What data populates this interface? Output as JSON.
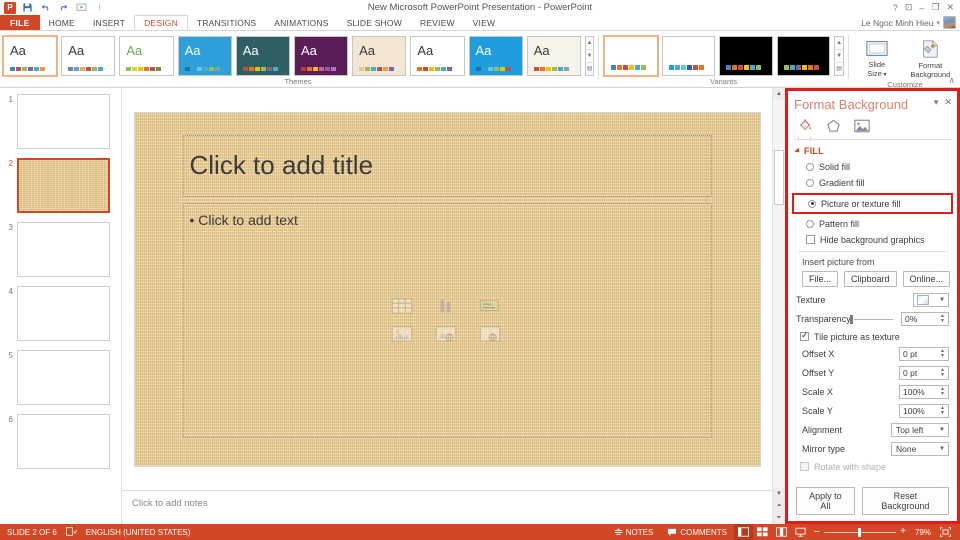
{
  "titlebar": {
    "app_logo": "powerpoint-logo",
    "title": "New Microsoft PowerPoint Presentation - PowerPoint",
    "qat": [
      {
        "name": "save-icon",
        "glyph": "■"
      },
      {
        "name": "undo-icon",
        "glyph": "↶"
      },
      {
        "name": "redo-icon",
        "glyph": "↻"
      },
      {
        "name": "start-slideshow-icon",
        "glyph": "▣"
      },
      {
        "name": "customize-qat-icon",
        "glyph": "≡"
      }
    ],
    "window_controls": [
      {
        "name": "help-button",
        "glyph": "?"
      },
      {
        "name": "ribbon-display-options-button",
        "glyph": "⬚"
      },
      {
        "name": "minimize-button",
        "glyph": "–"
      },
      {
        "name": "restore-button",
        "glyph": "❐"
      },
      {
        "name": "close-button",
        "glyph": "✕"
      }
    ]
  },
  "tabs": {
    "file": "FILE",
    "items": [
      {
        "label": "HOME",
        "active": false
      },
      {
        "label": "INSERT",
        "active": false
      },
      {
        "label": "DESIGN",
        "active": true
      },
      {
        "label": "TRANSITIONS",
        "active": false
      },
      {
        "label": "ANIMATIONS",
        "active": false
      },
      {
        "label": "SLIDE SHOW",
        "active": false
      },
      {
        "label": "REVIEW",
        "active": false
      },
      {
        "label": "VIEW",
        "active": false
      }
    ],
    "account_name": "Le Ngoc Minh Hieu"
  },
  "ribbon": {
    "themes_group_label": "Themes",
    "variants_group_label": "Variants",
    "customize_group_label": "Customize",
    "themes": [
      {
        "name": "theme-office",
        "aa": "Aa",
        "selected": true,
        "bg": "#ffffff",
        "aa_color": "#3a3a3a",
        "swatches": [
          "#4f81bd",
          "#c0504d",
          "#9bbb59",
          "#8064a2",
          "#4bacc6",
          "#f79646"
        ]
      },
      {
        "name": "theme-blank",
        "aa": "Aa",
        "selected": false,
        "bg": "#ffffff",
        "aa_color": "#3a3a3a",
        "swatches": [
          "#5a8ac6",
          "#6d9ed4",
          "#f0ad4e",
          "#c0504d",
          "#9bbb59",
          "#4bacc6"
        ]
      },
      {
        "name": "theme-facet",
        "aa": "Aa",
        "selected": false,
        "bg": "#ffffff",
        "aa_color": "#6aa84f",
        "swatches": [
          "#9bbb59",
          "#cbdb2a",
          "#f2c200",
          "#e8751a",
          "#c0504d",
          "#77933c"
        ]
      },
      {
        "name": "theme-ion",
        "aa": "Aa",
        "selected": false,
        "bg": "#2e9fd8",
        "aa_color": "#ffffff",
        "swatches": [
          "#1f6fa8",
          "#2e9fd8",
          "#68c4e0",
          "#4bacc6",
          "#9bbb59",
          "#76a5af"
        ]
      },
      {
        "name": "theme-slice",
        "aa": "Aa",
        "selected": false,
        "bg": "#2e5f63",
        "aa_color": "#ffffff",
        "swatches": [
          "#c0504d",
          "#e8751a",
          "#f2c200",
          "#9bbb59",
          "#8064a2",
          "#4bacc6"
        ]
      },
      {
        "name": "theme-berlin",
        "aa": "Aa",
        "selected": false,
        "bg": "#5b1d57",
        "aa_color": "#ffffff",
        "swatches": [
          "#c0392b",
          "#e8751a",
          "#f2c200",
          "#d45aa2",
          "#8064a2",
          "#c06ad0"
        ]
      },
      {
        "name": "theme-wood-type",
        "aa": "Aa",
        "selected": false,
        "bg": "#f3e7d3",
        "aa_color": "#3a3a3a",
        "swatches": [
          "#e8c98c",
          "#9bbb59",
          "#4bacc6",
          "#c0504d",
          "#f79646",
          "#8064a2"
        ]
      },
      {
        "name": "theme-retrospect",
        "aa": "Aa",
        "selected": false,
        "bg": "#ffffff",
        "aa_color": "#3a3a3a",
        "swatches": [
          "#e8751a",
          "#c0504d",
          "#f2c200",
          "#9bbb59",
          "#4bacc6",
          "#8064a2"
        ]
      },
      {
        "name": "theme-droplet",
        "aa": "Aa",
        "selected": false,
        "bg": "#1f9ede",
        "aa_color": "#ffffff",
        "swatches": [
          "#1f6fa8",
          "#2e9fd8",
          "#68c4e0",
          "#9bbb59",
          "#f2c200",
          "#c0504d"
        ]
      },
      {
        "name": "theme-organic",
        "aa": "Aa",
        "selected": false,
        "bg": "#f7f3e8",
        "aa_color": "#3a3a3a",
        "swatches": [
          "#c0504d",
          "#e8751a",
          "#f2c200",
          "#9bbb59",
          "#4bacc6",
          "#76a5af"
        ]
      }
    ],
    "variants": [
      {
        "name": "variant-1",
        "selected": true,
        "bg": "#ffffff",
        "swatches": [
          "#4f81bd",
          "#e8751a",
          "#c0504d",
          "#f2c200",
          "#4bacc6",
          "#9bbb59"
        ]
      },
      {
        "name": "variant-2",
        "selected": false,
        "bg": "#ffffff",
        "swatches": [
          "#1f9ede",
          "#4bacc6",
          "#68c4e0",
          "#2e5f9e",
          "#c0504d",
          "#e8751a"
        ]
      },
      {
        "name": "variant-3",
        "selected": false,
        "bg": "#000000",
        "swatches": [
          "#4f81bd",
          "#e8751a",
          "#c0504d",
          "#f2c200",
          "#4bacc6",
          "#9bbb59"
        ]
      },
      {
        "name": "variant-4",
        "selected": false,
        "bg": "#000000",
        "swatches": [
          "#9bbb59",
          "#4bacc6",
          "#8064a2",
          "#f2c200",
          "#e8751a",
          "#c0504d"
        ]
      }
    ],
    "slide_size_label": "Slide\nSize",
    "slide_size_line1": "Slide",
    "slide_size_line2": "Size",
    "format_background_line1": "Format",
    "format_background_line2": "Background",
    "collapse_ribbon_glyph": "∧"
  },
  "thumbnails": [
    {
      "num": "1",
      "selected": false,
      "textured": false
    },
    {
      "num": "2",
      "selected": true,
      "textured": true
    },
    {
      "num": "3",
      "selected": false,
      "textured": false
    },
    {
      "num": "4",
      "selected": false,
      "textured": false
    },
    {
      "num": "5",
      "selected": false,
      "textured": false
    },
    {
      "num": "6",
      "selected": false,
      "textured": false
    }
  ],
  "slide": {
    "title_placeholder": "Click to add title",
    "body_placeholder": "• Click to add text",
    "content_icons": [
      {
        "name": "insert-table-icon"
      },
      {
        "name": "insert-chart-icon"
      },
      {
        "name": "insert-smartart-icon"
      },
      {
        "name": "insert-picture-icon"
      },
      {
        "name": "insert-online-picture-icon"
      },
      {
        "name": "insert-video-icon"
      }
    ]
  },
  "notes": {
    "placeholder": "Click to add notes"
  },
  "format_background": {
    "title": "Format Background",
    "panel_options_glyph": "▾",
    "close_glyph": "✕",
    "icon_tabs": [
      {
        "name": "fill-bucket-icon",
        "active": true
      },
      {
        "name": "effects-pentagon-icon",
        "active": false
      },
      {
        "name": "picture-icon",
        "active": false
      }
    ],
    "fill_section_label": "FILL",
    "fill_options": [
      {
        "label": "Solid fill",
        "selected": false,
        "highlighted": false
      },
      {
        "label": "Gradient fill",
        "selected": false,
        "highlighted": false
      },
      {
        "label": "Picture or texture fill",
        "selected": true,
        "highlighted": true
      },
      {
        "label": "Pattern fill",
        "selected": false,
        "highlighted": false
      }
    ],
    "hide_background_graphics": {
      "label": "Hide background graphics",
      "checked": false
    },
    "insert_picture_from_label": "Insert picture from",
    "insert_buttons": [
      {
        "label": "File..."
      },
      {
        "label": "Clipboard"
      },
      {
        "label": "Online..."
      }
    ],
    "texture_label": "Texture",
    "transparency_label": "Transparency",
    "transparency_value": "0%",
    "tile_picture_as_texture": {
      "label": "Tile picture as texture",
      "checked": true
    },
    "fields": [
      {
        "label": "Offset X",
        "value": "0 pt",
        "type": "spinner"
      },
      {
        "label": "Offset Y",
        "value": "0 pt",
        "type": "spinner"
      },
      {
        "label": "Scale X",
        "value": "100%",
        "type": "spinner"
      },
      {
        "label": "Scale Y",
        "value": "100%",
        "type": "spinner"
      },
      {
        "label": "Alignment",
        "value": "Top left",
        "type": "combo"
      },
      {
        "label": "Mirror type",
        "value": "None",
        "type": "combo"
      }
    ],
    "rotate_with_shape": {
      "label": "Rotate with shape",
      "checked": false,
      "disabled": true
    },
    "apply_to_all_label": "Apply to All",
    "reset_background_label": "Reset Background"
  },
  "statusbar": {
    "slide_indicator": "SLIDE 2 OF 6",
    "language": "ENGLISH (UNITED STATES)",
    "notes_label": "NOTES",
    "comments_label": "COMMENTS",
    "view_buttons": [
      {
        "name": "normal-view-button",
        "active": true
      },
      {
        "name": "slide-sorter-view-button",
        "active": false
      },
      {
        "name": "reading-view-button",
        "active": false
      },
      {
        "name": "slideshow-view-button",
        "active": false
      }
    ],
    "zoom_out_glyph": "–",
    "zoom_in_glyph": "+",
    "zoom_level": "79%",
    "fit_to_window_name": "fit-slide-to-window-button"
  },
  "colors": {
    "accent": "#d24726",
    "highlight_red": "#e01b1b",
    "panel_title": "#d98070",
    "slide_bg": "#e9cb90"
  }
}
